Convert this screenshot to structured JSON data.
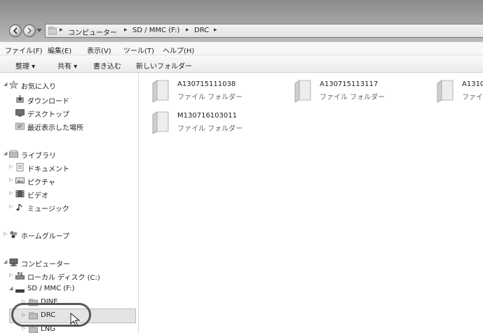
{
  "address_bar": {
    "breadcrumbs": [
      "コンピューター",
      "SD / MMC (F:)",
      "DRC"
    ],
    "separator": "▸"
  },
  "menu": [
    "ファイル(F)",
    "編集(E)",
    "表示(V)",
    "ツール(T)",
    "ヘルプ(H)"
  ],
  "toolbar": {
    "organize": "整理 ▾",
    "share": "共有 ▾",
    "burn": "書き込む",
    "new_folder": "新しいフォルダー"
  },
  "nav_pane": {
    "favorites": {
      "label": "お気に入り",
      "items": [
        "ダウンロード",
        "デスクトップ",
        "最近表示した場所"
      ]
    },
    "libraries": {
      "label": "ライブラリ",
      "items": [
        "ドキュメント",
        "ピクチャ",
        "ビデオ",
        "ミュージック"
      ]
    },
    "homegroup": {
      "label": "ホームグループ"
    },
    "computer": {
      "label": "コンピューター",
      "local_disk": "ローカル ディスク (C:)",
      "sd_card": "SD / MMC (F:)",
      "sd_children": [
        "DINE",
        "DRC",
        "LNG"
      ]
    },
    "selected": "DRC"
  },
  "content": {
    "folders": [
      {
        "name": "A130715111038",
        "type": "ファイル フォルダー"
      },
      {
        "name": "A130715113117",
        "type": "ファイル フォルダー"
      },
      {
        "name": "A1310",
        "type": "ファイ"
      },
      {
        "name": "M130716103011",
        "type": "ファイル フォルダー"
      }
    ]
  },
  "colors": {
    "titlebar": "#a4a4a4",
    "selection": "#e4e4e4",
    "callout": "#585858"
  }
}
